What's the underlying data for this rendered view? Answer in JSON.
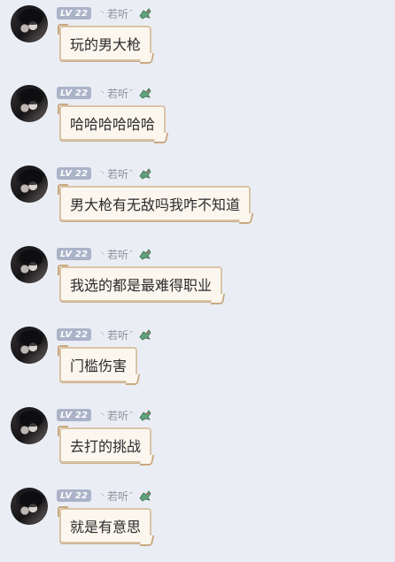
{
  "sender": {
    "level_badge": "LV 22",
    "wing_glyph": "⸌",
    "name": "若听",
    "name_suffix": "″",
    "pet_icon": "dragon-pet-icon",
    "bubble_bg": "#fbf6ee",
    "bubble_border": "#d9c3a6",
    "level_color": "#aab3c8"
  },
  "messages": [
    {
      "text": "玩的男大枪"
    },
    {
      "text": "哈哈哈哈哈哈"
    },
    {
      "text": "男大枪有无敌吗我咋不知道"
    },
    {
      "text": "我选的都是最难得职业"
    },
    {
      "text": "门槛伤害"
    },
    {
      "text": "去打的挑战"
    },
    {
      "text": "就是有意思"
    }
  ]
}
